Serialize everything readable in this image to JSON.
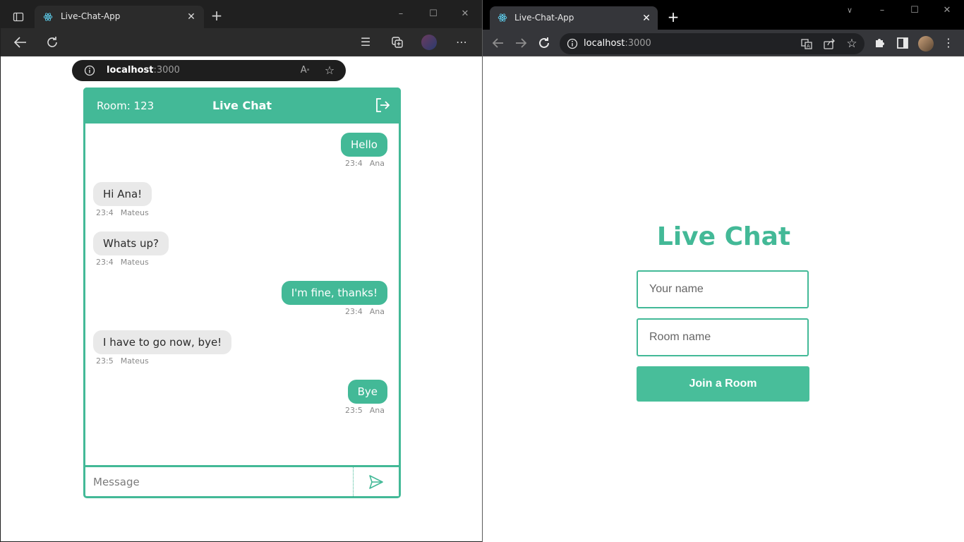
{
  "left_window": {
    "browser": "edge",
    "tab": {
      "title": "Live-Chat-App"
    },
    "address": {
      "host": "localhost",
      "port": ":3000"
    },
    "chat": {
      "room_label": "Room: 123",
      "title": "Live Chat",
      "messages": [
        {
          "text": "Hello",
          "time": "23:4",
          "author": "Ana",
          "own": true
        },
        {
          "text": "Hi Ana!",
          "time": "23:4",
          "author": "Mateus",
          "own": false
        },
        {
          "text": "Whats up?",
          "time": "23:4",
          "author": "Mateus",
          "own": false
        },
        {
          "text": "I'm fine, thanks!",
          "time": "23:4",
          "author": "Ana",
          "own": true
        },
        {
          "text": "I have to go now, bye!",
          "time": "23:5",
          "author": "Mateus",
          "own": false
        },
        {
          "text": "Bye",
          "time": "23:5",
          "author": "Ana",
          "own": true
        }
      ],
      "input_placeholder": "Message",
      "input_value": ""
    }
  },
  "right_window": {
    "browser": "chrome",
    "tab": {
      "title": "Live-Chat-App"
    },
    "address": {
      "host": "localhost",
      "port": ":3000"
    },
    "join": {
      "title": "Live Chat",
      "name_placeholder": "Your name",
      "name_value": "",
      "room_placeholder": "Room name",
      "room_value": "",
      "button_label": "Join a Room"
    }
  },
  "colors": {
    "accent": "#43b997",
    "button": "#48be9a",
    "bubble_other": "#e9e9e9"
  },
  "icons": [
    "react-logo-icon",
    "back-arrow-icon",
    "forward-arrow-icon",
    "reload-icon",
    "info-icon",
    "read-aloud-icon",
    "favorite-add-icon",
    "favorites-icon",
    "collections-icon",
    "profile-avatar",
    "more-icon",
    "exit-icon",
    "send-icon",
    "translate-icon",
    "share-icon",
    "star-icon",
    "extensions-icon",
    "side-panel-icon",
    "kebab-menu-icon"
  ]
}
